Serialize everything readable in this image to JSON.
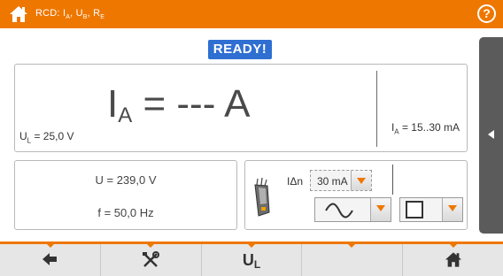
{
  "header": {
    "title_prefix": "RCD: I",
    "title_sub_a": "A",
    "title_mid": ", U",
    "title_sub_b": "B",
    "title_mid2": ", R",
    "title_sub_e": "E",
    "help_label": "?"
  },
  "status": {
    "ready": "READY!"
  },
  "measurement": {
    "main_symbol": "I",
    "main_sub": "A",
    "main_value": " = --- A",
    "ul_symbol": "U",
    "ul_sub": "L",
    "ul_value": " = 25,0 V",
    "range_symbol": "I",
    "range_sub": "A",
    "range_value": " = 15..30 mA"
  },
  "voltage": {
    "u": "U = 239,0 V",
    "f": "f = 50,0 Hz"
  },
  "settings": {
    "idn_label": "IΔn",
    "current_value": "30 mA",
    "waveform_icon": "sine-wave-icon",
    "type_icon": "square-type-icon"
  },
  "toolbar": {
    "back_icon": "back-arrow-icon",
    "tools_icon": "tools-icon",
    "ul_symbol": "U",
    "ul_sub": "L",
    "home_icon": "home-icon"
  },
  "colors": {
    "accent": "#ee7700",
    "ready": "#2f6fd2",
    "side_tab": "#5b5b5b"
  }
}
